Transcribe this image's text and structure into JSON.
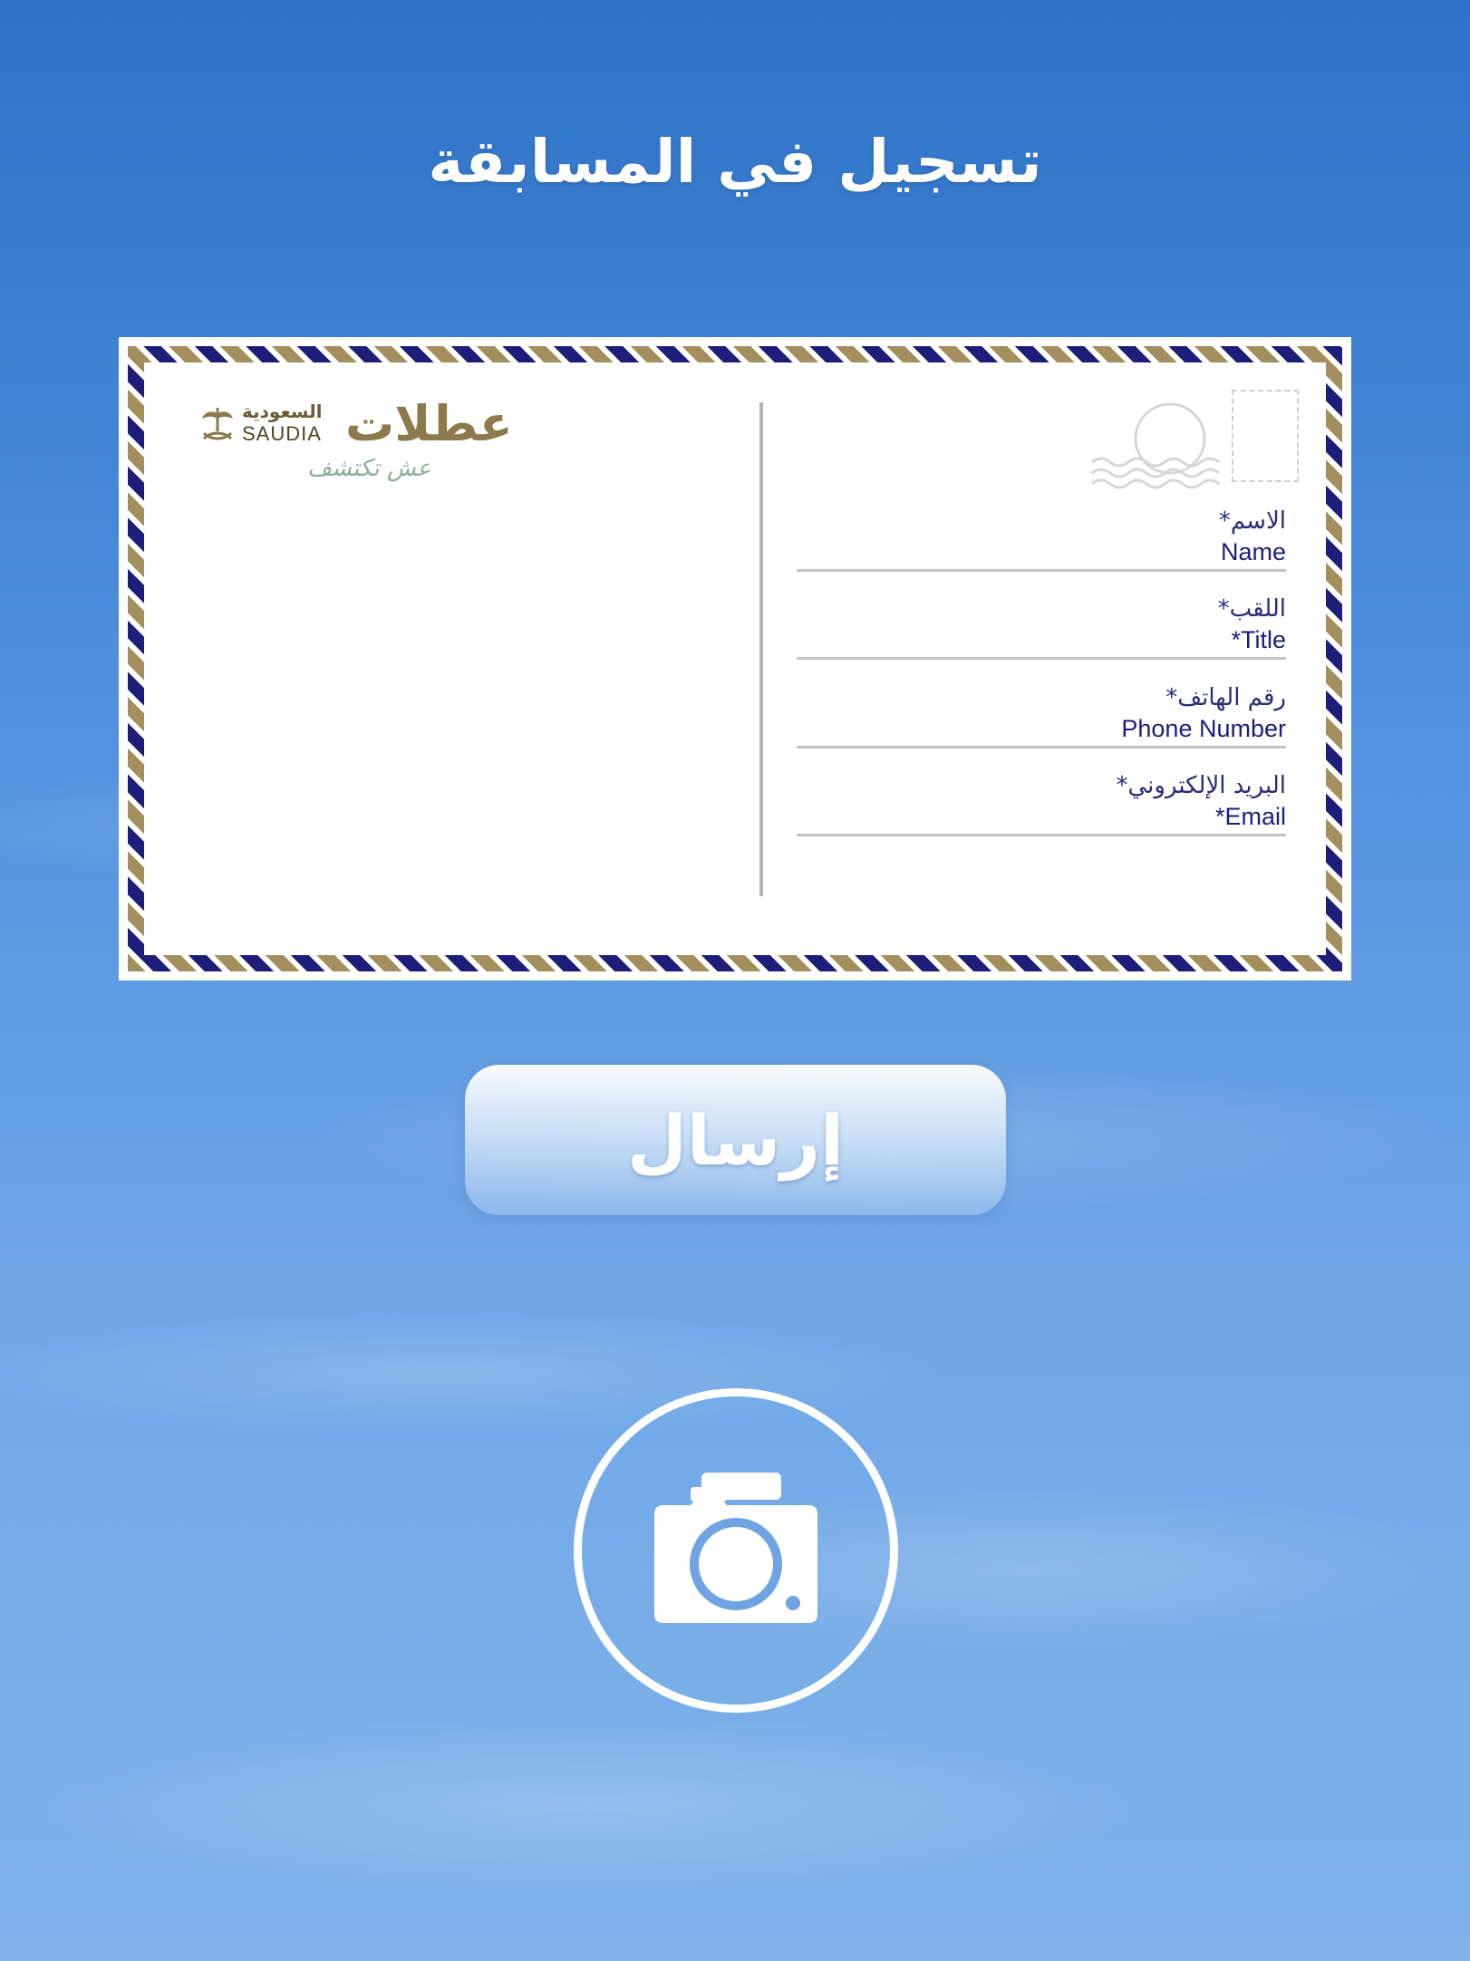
{
  "page": {
    "title": "تسجيل في المسابقة"
  },
  "postcard": {
    "brand": {
      "saudia_ar": "السعودية",
      "saudia_en": "SAUDIA",
      "otlat_logo": "عطلات",
      "slogan": "عش تكتشف"
    },
    "fields": [
      {
        "label_ar": "الاسم*",
        "label_en": "Name"
      },
      {
        "label_ar": "اللقب*",
        "label_en": "*Title"
      },
      {
        "label_ar": "رقم الهاتف*",
        "label_en": "Phone Number"
      },
      {
        "label_ar": "البريد الإلكتروني*",
        "label_en": "*Email"
      }
    ],
    "colors": {
      "border_gold": "#a38f5d",
      "border_navy": "#1f1d7a",
      "text_navy": "#1f1d7a"
    }
  },
  "actions": {
    "submit_label": "إرسال",
    "camera_icon": "camera-icon"
  }
}
